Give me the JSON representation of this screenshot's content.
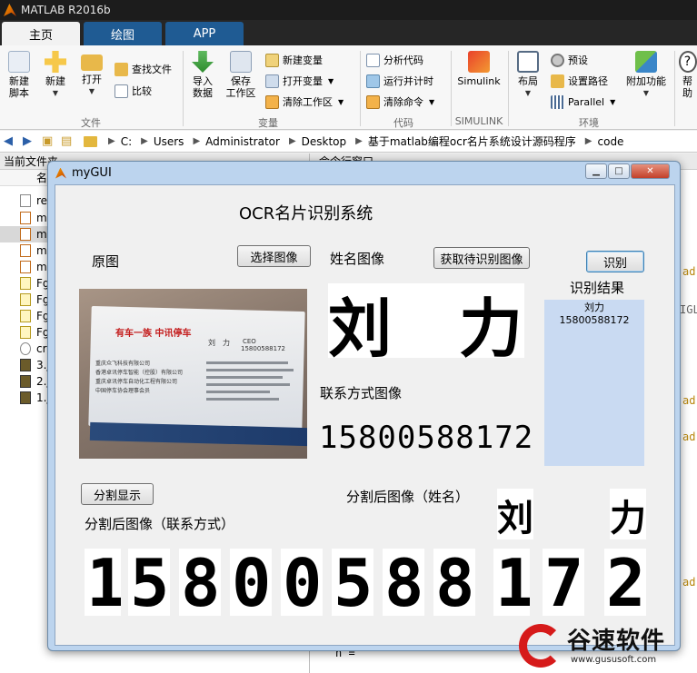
{
  "matlab": {
    "title": "MATLAB R2016b",
    "tabs": [
      {
        "label": "主页"
      },
      {
        "label": "绘图"
      },
      {
        "label": "APP"
      }
    ],
    "ribbon": {
      "new_script": "新建\n脚本",
      "new": "新建",
      "open": "打开",
      "find_files": "查找文件",
      "compare": "比较",
      "import_data": "导入\n数据",
      "save_workspace": "保存\n工作区",
      "new_variable": "新建变量",
      "open_variable": "打开变量",
      "clear_workspace": "清除工作区",
      "analyze_code": "分析代码",
      "run_and_time": "运行并计时",
      "clear_commands": "清除命令",
      "simulink": "Simulink",
      "layout": "布局",
      "preferences": "预设",
      "set_path": "设置路径",
      "parallel": "Parallel",
      "add_ons": "附加功能",
      "help": "帮助",
      "group_file": "文件",
      "group_variable": "变量",
      "group_code": "代码",
      "group_simulink": "SIMULINK",
      "group_environment": "环境"
    },
    "address": [
      "C:",
      "Users",
      "Administrator",
      "Desktop",
      "基于matlab编程ocr名片系统设计源码程序",
      "code"
    ],
    "current_folder_title": "当前文件夹",
    "current_folder_header": "名",
    "files": [
      "re",
      "m",
      "m",
      "m",
      "m",
      "Fg",
      "Fg",
      "Fg",
      "Fg",
      "cr",
      "3.j",
      "2.j",
      "1.j"
    ],
    "command_window_title": "命令行窗口",
    "command_fragments": [
      "ad",
      "IGLI",
      "ad",
      "ad",
      "ad",
      "n ="
    ]
  },
  "gui": {
    "window_title": "myGUI",
    "heading": "OCR名片识别系统",
    "label_original": "原图",
    "btn_select_image": "选择图像",
    "label_name_image": "姓名图像",
    "btn_get_image": "获取待识别图像",
    "btn_recognize": "识别",
    "label_result": "识别结果",
    "result_lines": [
      "刘力",
      "15800588172"
    ],
    "label_contact_image": "联系方式图像",
    "name_image_chars": [
      "刘",
      "力"
    ],
    "contact_image_text": "15800588172",
    "btn_segment": "分割显示",
    "label_seg_contact": "分割后图像（联系方式）",
    "label_seg_name": "分割后图像（姓名）",
    "seg_name_chars": [
      "刘",
      "力"
    ],
    "seg_contact_chars": [
      "1",
      "5",
      "8",
      "0",
      "0",
      "5",
      "8",
      "8",
      "1",
      "7",
      "2"
    ],
    "card": {
      "logo": "有车一族 中讯停车",
      "person": "刘　力",
      "title": "CEO",
      "phone": "15800588172",
      "company_lines": [
        "重庆众飞科技有限公司",
        "香港卓讯停车智能（控股）有限公司",
        "重庆卓讯停车自动化工程有限公司",
        "中国停车协会理事会员"
      ]
    }
  },
  "watermark": {
    "text": "谷速软件",
    "url": "www.gususoft.com"
  },
  "colors": {
    "ribbon_tab_active": "#f2f2f2",
    "ribbon_tab_inactive": "#1f5b93",
    "window_frame": "#bcd4ee",
    "result_box": "#c9daf2",
    "watermark_red": "#d61a1a"
  }
}
